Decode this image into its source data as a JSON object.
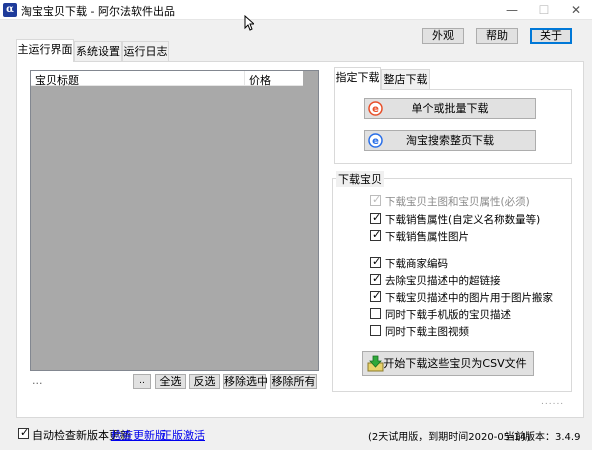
{
  "window": {
    "title": "淘宝宝贝下载 - 阿尔法软件出品",
    "icon_glyph": "α",
    "minimize_glyph": "—",
    "maximize_glyph": "☐",
    "close_glyph": "✕"
  },
  "top_buttons": {
    "appearance": "外观",
    "help": "帮助",
    "about": "关于"
  },
  "main_tabs": [
    "主运行界面",
    "系统设置",
    "运行日志"
  ],
  "list": {
    "columns": [
      "宝贝标题",
      "价格"
    ]
  },
  "list_footer": {
    "ellipsis": "...",
    "small_button": "..",
    "select_all": "全选",
    "invert": "反选",
    "remove_selected": "移除选中",
    "remove_all": "移除所有"
  },
  "download_tabs": [
    "指定下载",
    "整店下载"
  ],
  "download_buttons": {
    "single_batch": "单个或批量下载",
    "search_page": "淘宝搜索整页下载"
  },
  "options_group": {
    "title": "下载宝贝",
    "items": [
      {
        "label": "下载宝贝主图和宝贝属性(必须)",
        "checked": true,
        "disabled": true
      },
      {
        "label": "下载销售属性(自定义名称数量等)",
        "checked": true,
        "disabled": false
      },
      {
        "label": "下载销售属性图片",
        "checked": true,
        "disabled": false
      },
      {
        "label": "下载商家编码",
        "checked": true,
        "disabled": false
      },
      {
        "label": "去除宝贝描述中的超链接",
        "checked": true,
        "disabled": false
      },
      {
        "label": "下载宝贝描述中的图片用于图片搬家",
        "checked": true,
        "disabled": false
      },
      {
        "label": "同时下载手机版的宝贝描述",
        "checked": false,
        "disabled": false
      },
      {
        "label": "同时下载主图视频",
        "checked": false,
        "disabled": false
      }
    ],
    "start_button": "开始下载这些宝贝为CSV文件"
  },
  "dots": "......",
  "statusbar": {
    "auto_check_label": "自动检查新版本更新",
    "auto_check_checked": true,
    "check_update_link": "检查更新版",
    "buy_link": "正版激活",
    "trial_text": "(2天试用版，到期时间2020-05-14)",
    "version_text": "当前版本：3.4.9"
  },
  "colors": {
    "list_bg": "#a9a9a9",
    "accent": "#0078d7",
    "link": "#0000ee"
  }
}
